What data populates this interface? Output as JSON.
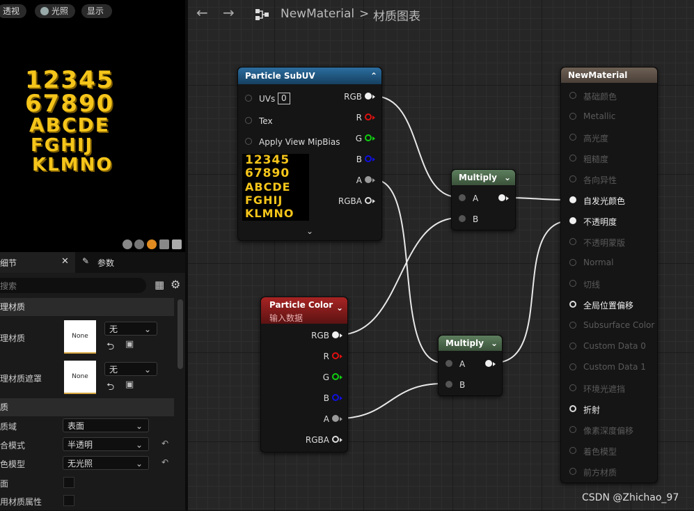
{
  "viewport": {
    "buttons": {
      "perspective": "透视",
      "lit": "光照",
      "show": "显示"
    },
    "glyph_rows": [
      "12345",
      "67890",
      "ABCDE",
      "FGHIJ",
      "KLMNO"
    ]
  },
  "details": {
    "tab_details": "细节",
    "tab_params": "参数",
    "search_placeholder": "搜索",
    "cat_physical": "理材质",
    "phys_material_label": "理材质",
    "phys_material_thumb": "None",
    "phys_material_combo": "无",
    "phys_mask_label": "理材质遮罩",
    "phys_mask_thumb": "None",
    "phys_mask_combo": "无",
    "cat_material": "质",
    "domain_label": "质域",
    "domain_value": "表面",
    "blend_label": "合模式",
    "blend_value": "半透明",
    "shading_label": "色模型",
    "shading_value": "无光照",
    "twosided_label": "面",
    "usemat_label": "用材质属性"
  },
  "graph": {
    "breadcrumb_asset": "NewMaterial",
    "breadcrumb_sep": ">",
    "breadcrumb_graph": "材质图表",
    "watermark": "CSDN @Zhichao_97"
  },
  "nodes": {
    "subuv": {
      "title": "Particle SubUV",
      "inputs": [
        "UVs",
        "Tex",
        "Apply View MipBias"
      ],
      "uvs_value": "0",
      "outputs": [
        "RGB",
        "R",
        "G",
        "B",
        "A",
        "RGBA"
      ]
    },
    "particle_color": {
      "title": "Particle Color",
      "subtitle": "输入数据",
      "outputs": [
        "RGB",
        "R",
        "G",
        "B",
        "A",
        "RGBA"
      ]
    },
    "multiply1": {
      "title": "Multiply",
      "inputs": [
        "A",
        "B"
      ]
    },
    "multiply2": {
      "title": "Multiply",
      "inputs": [
        "A",
        "B"
      ]
    },
    "result": {
      "title": "NewMaterial",
      "pins": [
        "基础颜色",
        "Metallic",
        "高光度",
        "粗糙度",
        "各向异性",
        "自发光颜色",
        "不透明度",
        "不透明蒙版",
        "Normal",
        "切线",
        "全局位置偏移",
        "Subsurface Color",
        "Custom Data 0",
        "Custom Data 1",
        "环境光遮挡",
        "折射",
        "像素深度偏移",
        "着色模型",
        "前方材质"
      ],
      "active": [
        "自发光颜色",
        "不透明度"
      ],
      "available": [
        "全局位置偏移",
        "折射"
      ]
    }
  },
  "colors": {
    "subuv_header": "#1f5c8a",
    "color_header": "#8a1d1d",
    "multiply_header": "#4c6a4c",
    "result_header": "#5b4f44",
    "glyph": "#f5c51a"
  }
}
